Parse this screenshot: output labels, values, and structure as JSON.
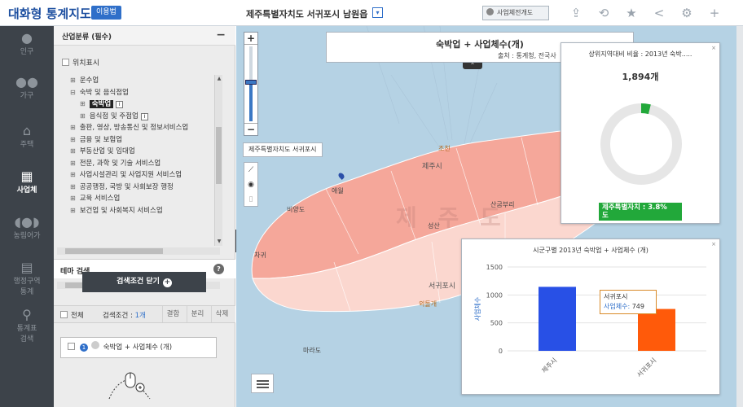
{
  "header": {
    "logo": "대화형 통계지도",
    "usage_button": "이용법",
    "region_title": "제주특별자치도 서귀포시 남원읍",
    "map_type_button": "사업체전개도",
    "tools": [
      {
        "icon": "upload-icon",
        "glyph": "⇪"
      },
      {
        "icon": "refresh-icon",
        "glyph": "⟲"
      },
      {
        "icon": "star-icon",
        "glyph": "★"
      },
      {
        "icon": "share-icon",
        "glyph": "<"
      },
      {
        "icon": "gear-icon",
        "glyph": "⚙"
      },
      {
        "icon": "plus-icon",
        "glyph": "+"
      }
    ]
  },
  "rail": {
    "items": [
      {
        "label": "인구",
        "icon": "person-icon",
        "glyph": "👤"
      },
      {
        "label": "가구",
        "icon": "family-icon",
        "glyph": "👪"
      },
      {
        "label": "주택",
        "icon": "house-icon",
        "glyph": "⌂"
      },
      {
        "label": "사업체",
        "icon": "building-icon",
        "glyph": "▦",
        "active": true
      },
      {
        "label": "농림어가",
        "icon": "pig-icon",
        "glyph": "🐖"
      },
      {
        "label": "행정구역",
        "label2": "통계",
        "icon": "map-icon",
        "glyph": "▤"
      },
      {
        "label": "통계표",
        "label2": "검색",
        "icon": "search-icon",
        "glyph": "⚲"
      }
    ]
  },
  "panel": {
    "title": "산업분류 (필수)",
    "minimize": "−",
    "position_check": "위치표시",
    "tree": [
      {
        "label": "운수업",
        "level": 0,
        "exp": "⊞"
      },
      {
        "label": "숙박 및 음식점업",
        "level": 0,
        "exp": "⊟"
      },
      {
        "label": "숙박업",
        "level": 1,
        "exp": "⊞",
        "selected": true,
        "info": "i"
      },
      {
        "label": "음식점 및 주점업",
        "level": 1,
        "exp": "⊞",
        "info": "i"
      },
      {
        "label": "출판, 영상, 방송통신 및 정보서비스업",
        "level": 0,
        "exp": "⊞"
      },
      {
        "label": "금융 및 보험업",
        "level": 0,
        "exp": "⊞"
      },
      {
        "label": "부동산업 및 임대업",
        "level": 0,
        "exp": "⊞"
      },
      {
        "label": "전문, 과학 및 기술 서비스업",
        "level": 0,
        "exp": "⊞"
      },
      {
        "label": "사업시설관리 및 사업지원 서비스업",
        "level": 0,
        "exp": "⊞"
      },
      {
        "label": "공공행정, 국방 및 사회보장 행정",
        "level": 0,
        "exp": "⊞"
      },
      {
        "label": "교육 서비스업",
        "level": 0,
        "exp": "⊞"
      },
      {
        "label": "보건업 및 사회복지 서비스업",
        "level": 0,
        "exp": "⊞"
      }
    ],
    "theme_search": "테마 검색",
    "help": "?",
    "search_close": "검색조건 닫기",
    "search_close_plus": "+",
    "cond_bar": {
      "all": "전체",
      "cond_label": "검색조건 : ",
      "cond_count": "1개",
      "buttons": [
        "결합",
        "분리",
        "삭제"
      ]
    },
    "cond_item": {
      "num1": "1",
      "num2": "",
      "label": "숙박업 + 사업체수 (개)"
    },
    "collapse": "◀"
  },
  "map": {
    "zoom_in": "+",
    "zoom_out": "−",
    "zoom_level": 0.45,
    "location_label": "제주특별자치도 서귀포시",
    "tools": [
      {
        "icon": "measure-icon",
        "glyph": "⟋"
      },
      {
        "icon": "pin-icon",
        "glyph": "⚲"
      },
      {
        "icon": "trash-icon",
        "glyph": "🗑"
      }
    ],
    "info_title": "숙박업 + 사업체수(개)",
    "info_source": "출처 : 통계청, 전국사",
    "info_toggle": "^",
    "labels": {
      "jeju_city": "제주시",
      "seogwipo_city": "서귀포시",
      "big_label": "제 주 도",
      "l1": "애월",
      "l2": "비양도",
      "l3": "차귀",
      "l4": "마라도",
      "l5": "조천",
      "l6": "산굼부리",
      "l7": "성산",
      "l8": "외돌개"
    }
  },
  "donut": {
    "title": "상위지역대비 비율 : 2013년 숙박.....",
    "close": "×",
    "value": "1,894개",
    "badge_line1": "제주특별자치 : 3.8%",
    "badge_line2": "도",
    "color_fill": "#22a83a",
    "color_track": "#e6e6e6"
  },
  "chart_data": {
    "type": "bar",
    "title": "시군구별 2013년 숙박업 + 사업체수 (개)",
    "categories": [
      "제주시",
      "서귀포시"
    ],
    "values": [
      1145,
      749
    ],
    "colors": [
      "#2850e6",
      "#ff5a0a"
    ],
    "ylabel": "사업체수",
    "ylim": [
      0,
      1500
    ],
    "yticks": [
      "0",
      "500",
      "1000",
      "1500"
    ],
    "grid": true,
    "tooltip": {
      "name": "서귀포시",
      "label": "사업체수",
      "value": "749"
    }
  }
}
